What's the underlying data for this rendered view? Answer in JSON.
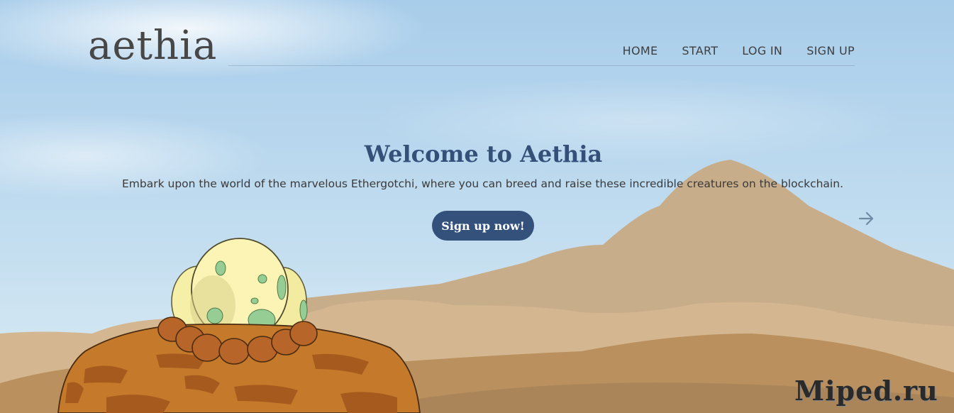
{
  "brand": {
    "logo_text": "aethia"
  },
  "nav": {
    "items": [
      {
        "label": "HOME"
      },
      {
        "label": "START"
      },
      {
        "label": "LOG IN"
      },
      {
        "label": "SIGN UP"
      }
    ]
  },
  "hero": {
    "title": "Welcome to Aethia",
    "subtitle": "Embark upon the world of the marvelous Ethergotchi, where you can breed and raise these incredible creatures on the blockchain.",
    "cta_label": "Sign up now!"
  },
  "carousel": {
    "next_icon": "arrow-right-icon"
  },
  "watermark": {
    "text": "Miped.ru"
  },
  "colors": {
    "sky_top": "#a9cdea",
    "sky_bottom": "#d6e9f3",
    "title": "#345079",
    "button": "#33517b",
    "mountain": "#c8ad8a",
    "sand": "#d4b690",
    "nest": "#c47a2a",
    "egg": "#f8f2b0",
    "egg_spot": "#96cd94"
  }
}
